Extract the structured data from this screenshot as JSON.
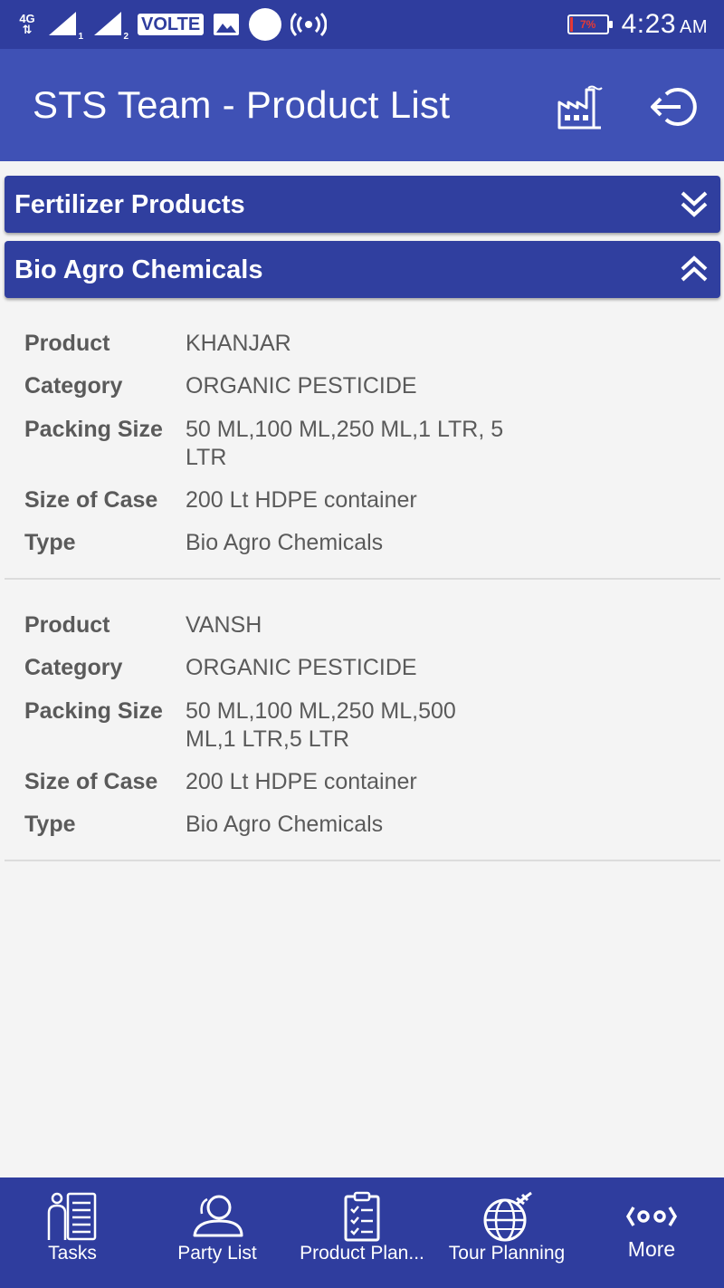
{
  "status_bar": {
    "network_type": "4G",
    "sim1": "1",
    "sim2": "2",
    "volte": "VOLTE",
    "battery_percent": "7%",
    "battery_level": 0.07,
    "battery_color": "#e53935",
    "time": "4:23",
    "ampm": "AM"
  },
  "app_bar": {
    "title": "STS Team - Product List",
    "icons": [
      "factory-icon",
      "logout-icon"
    ]
  },
  "sections": [
    {
      "label": "Fertilizer Products",
      "expanded": false
    },
    {
      "label": "Bio Agro Chemicals",
      "expanded": true
    }
  ],
  "field_labels": {
    "product": "Product",
    "category": "Category",
    "packing_size": "Packing Size",
    "size_of_case": "Size of Case",
    "type": "Type"
  },
  "products": [
    {
      "product": "KHANJAR",
      "category": "ORGANIC PESTICIDE",
      "packing_size": "50 ML,100 ML,250 ML,1 LTR, 5 LTR",
      "size_of_case": "200 Lt HDPE container",
      "type": "Bio Agro Chemicals"
    },
    {
      "product": "VANSH",
      "category": "ORGANIC PESTICIDE",
      "packing_size": "50 ML,100 ML,250 ML,500 ML,1 LTR,5 LTR",
      "size_of_case": "200 Lt HDPE container",
      "type": "Bio Agro Chemicals"
    }
  ],
  "bottom_nav": [
    {
      "label": "Tasks",
      "icon": "tasks-icon"
    },
    {
      "label": "Party List",
      "icon": "party-list-icon"
    },
    {
      "label": "Product Plan...",
      "icon": "product-plan-icon"
    },
    {
      "label": "Tour Planning",
      "icon": "tour-planning-icon"
    },
    {
      "label": "More",
      "icon": "more-icon"
    }
  ],
  "colors": {
    "status_bar": "#2f3d9e",
    "app_bar": "#3f51b5",
    "section_header": "#303f9f",
    "bottom_nav": "#2f3d9e",
    "background": "#f4f4f4",
    "text": "#5a5a5a"
  }
}
